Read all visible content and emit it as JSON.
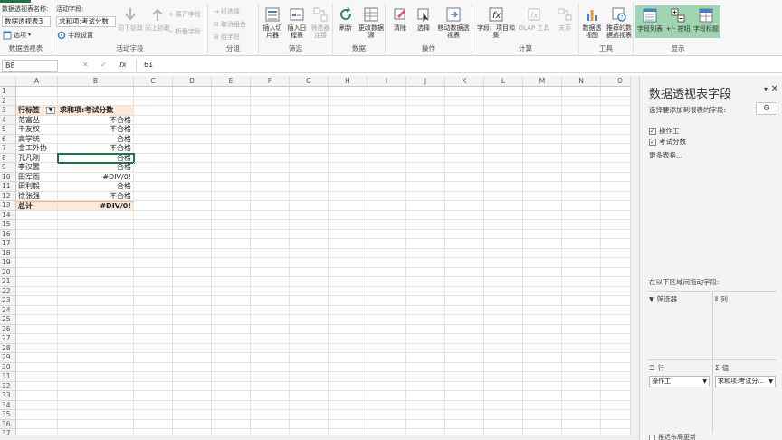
{
  "ribbon": {
    "pivot_name_label": "数据透视表名称:",
    "pivot_name_value": "数据透视表3",
    "options_label": "选项",
    "pivot_group": "数据透视表",
    "active_field_label": "活动字段:",
    "active_field_value": "求和项:考试分数",
    "field_settings": "字段设置",
    "drill_down": "向下钻取",
    "drill_up": "向上钻取",
    "expand_field": "展开字段",
    "collapse_field": "折叠字段",
    "active_field_group": "活动字段",
    "group_selection": "组选择",
    "ungroup": "取消组合",
    "group_field": "组字段",
    "group_group": "分组",
    "insert_slicer": "插入切片器",
    "insert_timeline": "插入日程表",
    "filter_connections": "筛选器连接",
    "filter_group": "筛选",
    "refresh": "刷新",
    "change_source": "更改数据源",
    "data_group": "数据",
    "clear": "清除",
    "select": "选择",
    "move_pivot": "移动数据透视表",
    "actions_group": "操作",
    "fields_items": "字段、项目和集",
    "olap_tools": "OLAP 工具",
    "relationships": "关系",
    "calc_group": "计算",
    "pivot_chart": "数据透视图",
    "recommended": "推荐的数据透视表",
    "tools_group": "工具",
    "field_list": "字段列表",
    "plus_minus": "+/- 按钮",
    "field_headers": "字段标题",
    "show_group": "显示"
  },
  "formula": {
    "name_box": "B8",
    "cancel": "✕",
    "enter": "✓",
    "fx": "fx",
    "value": "61"
  },
  "grid": {
    "columns": [
      "A",
      "B",
      "C",
      "D",
      "E",
      "F",
      "G",
      "H",
      "I",
      "J",
      "K",
      "L",
      "M",
      "N",
      "O"
    ],
    "rows": [
      "1",
      "2",
      "3",
      "4",
      "5",
      "6",
      "7",
      "8",
      "9",
      "10",
      "11",
      "12",
      "13",
      "14",
      "15",
      "16",
      "17",
      "18",
      "19",
      "20",
      "21",
      "22",
      "23",
      "24",
      "25",
      "26",
      "27",
      "28",
      "29",
      "30",
      "31",
      "32",
      "33",
      "34",
      "35",
      "36",
      "37"
    ],
    "pivot": {
      "row_label_header": "行标签",
      "value_header": "求和项:考试分数",
      "items": [
        {
          "name": "范富丛",
          "value": "不合格"
        },
        {
          "name": "干友权",
          "value": "不合格"
        },
        {
          "name": "高学统",
          "value": "合格"
        },
        {
          "name": "金工外协",
          "value": "不合格"
        },
        {
          "name": "孔凡刚",
          "value": "合格"
        },
        {
          "name": "李汉置",
          "value": "合格"
        },
        {
          "name": "田军雨",
          "value": "#DIV/0!"
        },
        {
          "name": "田利毅",
          "value": "合格"
        },
        {
          "name": "徐张强",
          "value": "不合格"
        }
      ],
      "total_label": "总计",
      "total_value": "#DIV/0!"
    }
  },
  "pane": {
    "title": "数据透视表字段",
    "subtitle": "选择要添加到报表的字段:",
    "fields": [
      {
        "label": "操作工",
        "checked": "✓"
      },
      {
        "label": "考试分数",
        "checked": "✓"
      }
    ],
    "more_tables": "更多表格...",
    "area_hint": "在以下区域间拖动字段:",
    "filters_label": "筛选器",
    "columns_label": "列",
    "rows_label": "行",
    "values_label": "值",
    "row_chip": "操作工",
    "value_chip": "求和项:考试分...",
    "defer_update": "推迟布局更新"
  }
}
